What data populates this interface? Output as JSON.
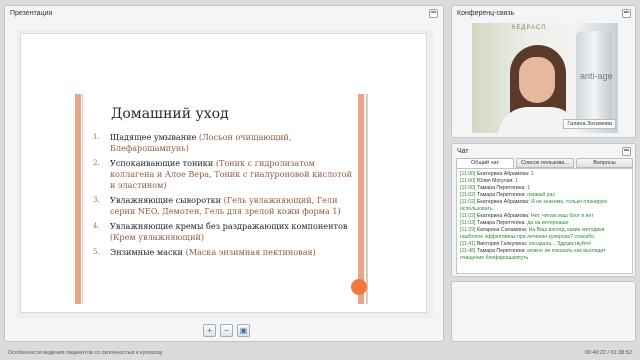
{
  "presentation": {
    "title": "Презентация",
    "slide": {
      "heading": "Домашний уход",
      "items": [
        {
          "num": "1.",
          "text": "Щадящее умывание ",
          "paren": "(Лосьон очищающий, Блефарошампунь)"
        },
        {
          "num": "2.",
          "text": "Успокаивающие тоники ",
          "paren": "(Тоник с гидролизатом коллагена и Алое Вера, Тоник с гиалуроновой кислотой и эластином)"
        },
        {
          "num": "3.",
          "text": "Увлажняющие сыворотки ",
          "paren": "(Гель увлажняющий, Гели серии NEO, Демотен, Гель для зрелой кожи форма 1)"
        },
        {
          "num": "4.",
          "text": "Увлажняющие кремы без раздражающих компонентов ",
          "paren": "(Крем увлажняющий)"
        },
        {
          "num": "5.",
          "text": "Энзимные маски ",
          "paren": "(Маска энзимная пектиновая)"
        }
      ]
    },
    "toolbar": {
      "zoom_in": "+",
      "zoom_out": "−",
      "save": "▣"
    }
  },
  "conference": {
    "title": "Конференц-связь",
    "speaker_name": "Галина Зосимова",
    "bottle_text": "anti-age",
    "sign_text": "КЕДРАСЛ"
  },
  "chat": {
    "title": "Чат",
    "tabs": [
      "Общий чат",
      "Список пользова...",
      "Вопросы"
    ],
    "messages": [
      {
        "time": "[11:00]",
        "name": "Екатерина Абрамова:",
        "text": "1"
      },
      {
        "time": "[11:00]",
        "name": "Юлия Могучая:",
        "text": "1"
      },
      {
        "time": "[11:00]",
        "name": "Тамара Перетягина:",
        "text": "1"
      },
      {
        "time": "[11:02]",
        "name": "Тамара Перетягина:",
        "text": "первый раз"
      },
      {
        "time": "[11:02]",
        "name": "Екатерина Абрамова:",
        "text": "Я не знакома, только планирую использовать."
      },
      {
        "time": "[11:02]",
        "name": "Екатерина Абрамова:",
        "text": "Нет, читаю ваш блог в инт"
      },
      {
        "time": "[11:03]",
        "name": "Тамара Перетягина:",
        "text": "да на интернаше"
      },
      {
        "time": "[11:29]",
        "name": "Катарина Саламина:",
        "text": "На Ваш взгляд, какие методики наиболее эффективны при лечении купероза? спасибо."
      },
      {
        "time": "[11:41]",
        "name": "Виктория Галкулина:",
        "text": "опоздала... Здравствуйте!"
      },
      {
        "time": "[11:48]",
        "name": "Тамара Перетягина:",
        "text": "можно ли показать как выглядит очищение блефарошампуть"
      }
    ]
  },
  "status": {
    "left": "Особенности ведения пациентов со склонностью к куперозу",
    "right": "00:49:22 / 01:38:52"
  }
}
